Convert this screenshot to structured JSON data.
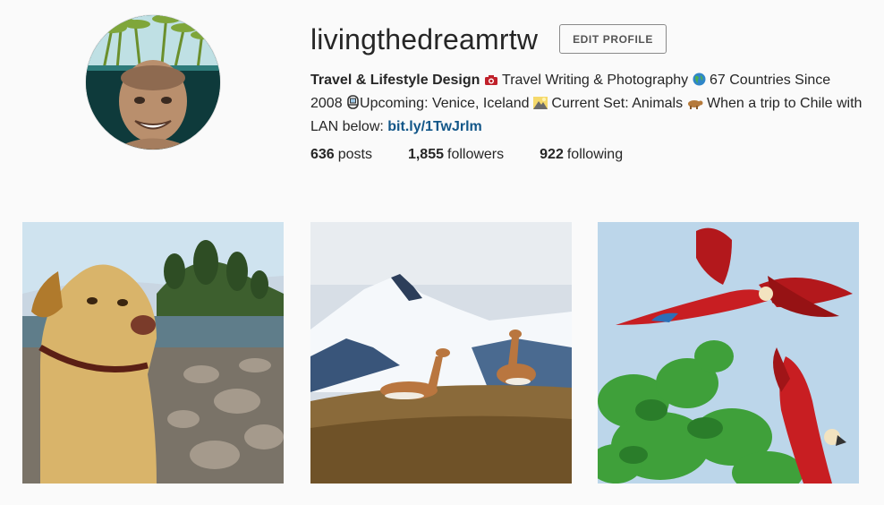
{
  "profile": {
    "username": "livingthedreamrtw",
    "edit_label": "EDIT PROFILE",
    "bio": {
      "name": "Travel & Lifestyle Design",
      "seg1": " Travel Writing & Photography ",
      "seg2": " 67 Countries Since 2008 ",
      "seg3": "Upcoming: Venice, Iceland ",
      "seg4": " Current Set: Animals ",
      "seg5": " When a trip to Chile with LAN below: ",
      "link": "bit.ly/1TwJrlm"
    },
    "icons": [
      "camera-emoji-icon",
      "globe-emoji-icon",
      "gondola-emoji-icon",
      "mountain-emoji-icon",
      "animal-emoji-icon"
    ]
  },
  "stats": {
    "posts_count": "636",
    "posts_label": "posts",
    "followers_count": "1,855",
    "followers_label": "followers",
    "following_count": "922",
    "following_label": "following"
  },
  "posts": [
    {
      "subject": "dog-by-lake-photo"
    },
    {
      "subject": "guanacos-mountains-photo"
    },
    {
      "subject": "macaws-flying-photo"
    }
  ],
  "colors": {
    "link": "#125688",
    "text": "#262626",
    "background": "#fafafa"
  }
}
